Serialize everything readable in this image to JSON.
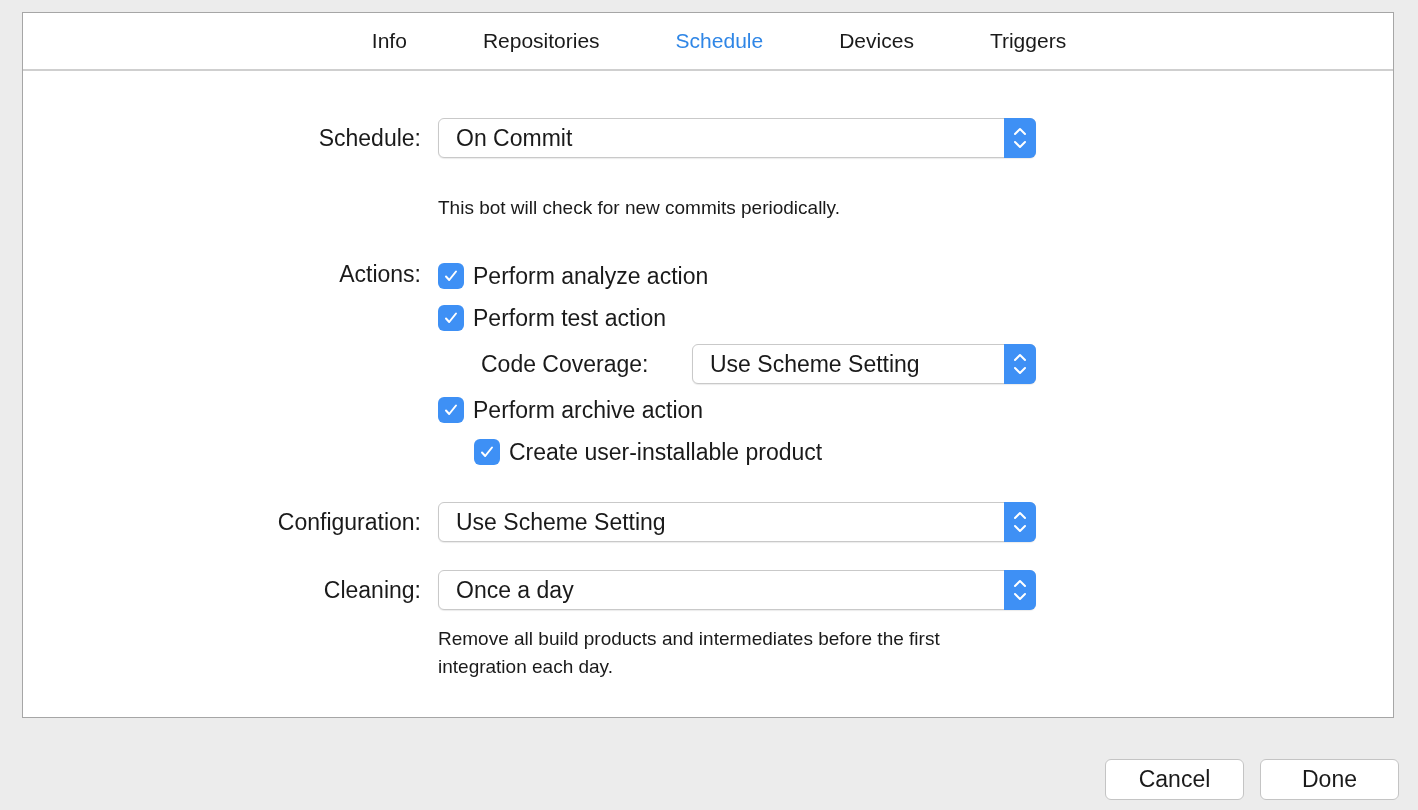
{
  "tabs": [
    {
      "label": "Info",
      "selected": false
    },
    {
      "label": "Repositories",
      "selected": false
    },
    {
      "label": "Schedule",
      "selected": true
    },
    {
      "label": "Devices",
      "selected": false
    },
    {
      "label": "Triggers",
      "selected": false
    }
  ],
  "schedule": {
    "label": "Schedule:",
    "value": "On Commit",
    "note": "This bot will check for new commits periodically."
  },
  "actions": {
    "label": "Actions:",
    "items": [
      {
        "kind": "checkbox",
        "label": "Perform analyze action",
        "checked": true
      },
      {
        "kind": "checkbox",
        "label": "Perform test action",
        "checked": true,
        "children": [
          {
            "kind": "popup",
            "label": "Code Coverage:",
            "value": "Use Scheme Setting"
          }
        ]
      },
      {
        "kind": "checkbox",
        "label": "Perform archive action",
        "checked": true,
        "children": [
          {
            "kind": "checkbox",
            "label": "Create user-installable product",
            "checked": true
          }
        ]
      }
    ]
  },
  "configuration": {
    "label": "Configuration:",
    "value": "Use Scheme Setting"
  },
  "cleaning": {
    "label": "Cleaning:",
    "value": "Once a day",
    "note": "Remove all build products and intermediates before the first integration each day."
  },
  "buttons": [
    "Cancel",
    "Done"
  ]
}
